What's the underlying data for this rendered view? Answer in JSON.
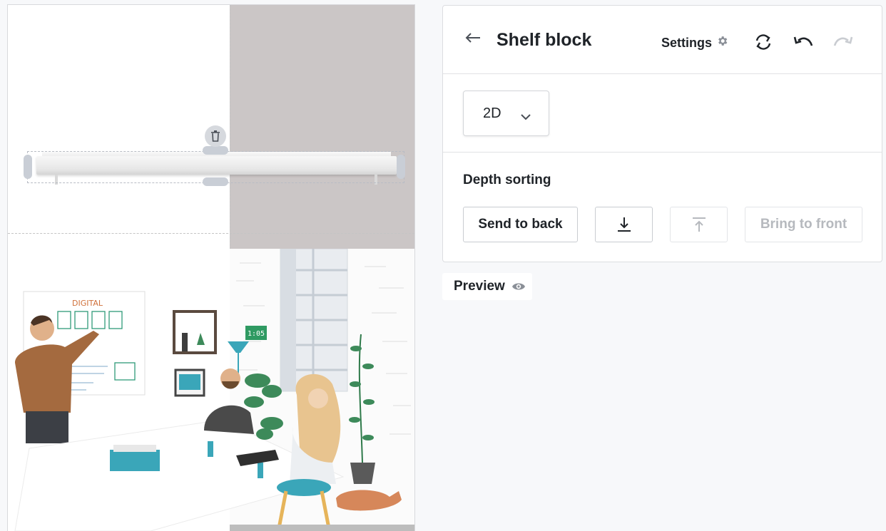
{
  "canvas": {
    "delete_icon": "trash-icon"
  },
  "panel": {
    "back_icon": "arrow-left-icon",
    "title": "Shelf block",
    "settings_label": "Settings",
    "settings_icon": "gear-icon",
    "toolbar_icons": [
      "sync-icon",
      "undo-icon",
      "redo-icon"
    ]
  },
  "view": {
    "selected": "2D",
    "icon": "chevron-down-icon"
  },
  "depth": {
    "label": "Depth sorting",
    "send_to_back": "Send to back",
    "send_backward_icon": "arrow-down-to-line-icon",
    "bring_forward_icon": "arrow-up-from-line-icon",
    "bring_to_front": "Bring to front"
  },
  "preview": {
    "label": "Preview",
    "icon": "eye-icon"
  },
  "colors": {
    "canvas_wall": "#cbc6c6",
    "disabled_text": "#b6b9be",
    "accent_teal": "#3aa6b9"
  }
}
